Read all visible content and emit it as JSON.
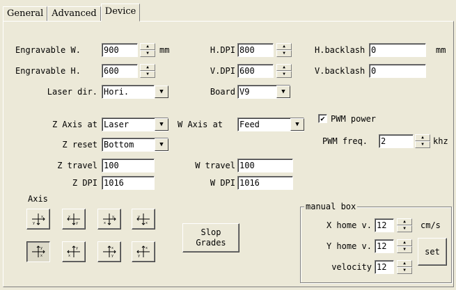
{
  "tabs": [
    "General",
    "Advanced",
    "Device"
  ],
  "engravable_w": {
    "label": "Engravable W.",
    "value": "900",
    "unit": "mm"
  },
  "engravable_h": {
    "label": "Engravable H.",
    "value": "600"
  },
  "laser_dir": {
    "label": "Laser dir.",
    "value": "Hori."
  },
  "h_dpi": {
    "label": "H.DPI",
    "value": "800"
  },
  "v_dpi": {
    "label": "V.DPI",
    "value": "600"
  },
  "board": {
    "label": "Board",
    "value": "V9"
  },
  "h_backlash": {
    "label": "H.backlash",
    "value": "0",
    "unit": "mm"
  },
  "v_backlash": {
    "label": "V.backlash",
    "value": "0"
  },
  "z_axis_at": {
    "label": "Z Axis at",
    "value": "Laser"
  },
  "w_axis_at": {
    "label": "W Axis at",
    "value": "Feed"
  },
  "z_reset": {
    "label": "Z reset",
    "value": "Bottom"
  },
  "z_travel": {
    "label": "Z travel",
    "value": "100"
  },
  "w_travel": {
    "label": "W travel",
    "value": "100"
  },
  "z_dpi": {
    "label": "Z DPI",
    "value": "1016"
  },
  "w_dpi": {
    "label": "W DPI",
    "value": "1016"
  },
  "pwm_power": {
    "label": "PWM power",
    "checked": true
  },
  "pwm_freq": {
    "label": "PWM freq.",
    "value": "2",
    "unit": "khz"
  },
  "axis_group": {
    "label": "Axis",
    "selected_index": 4
  },
  "slop_grades": {
    "label_line1": "Slop",
    "label_line2": "Grades"
  },
  "manual_box": {
    "label": "manual box",
    "x_home": {
      "label": "X home v.",
      "value": "12",
      "unit": "cm/s"
    },
    "y_home": {
      "label": "Y home v.",
      "value": "12"
    },
    "velocity": {
      "label": "velocity",
      "value": "12"
    },
    "set_label": "set"
  }
}
